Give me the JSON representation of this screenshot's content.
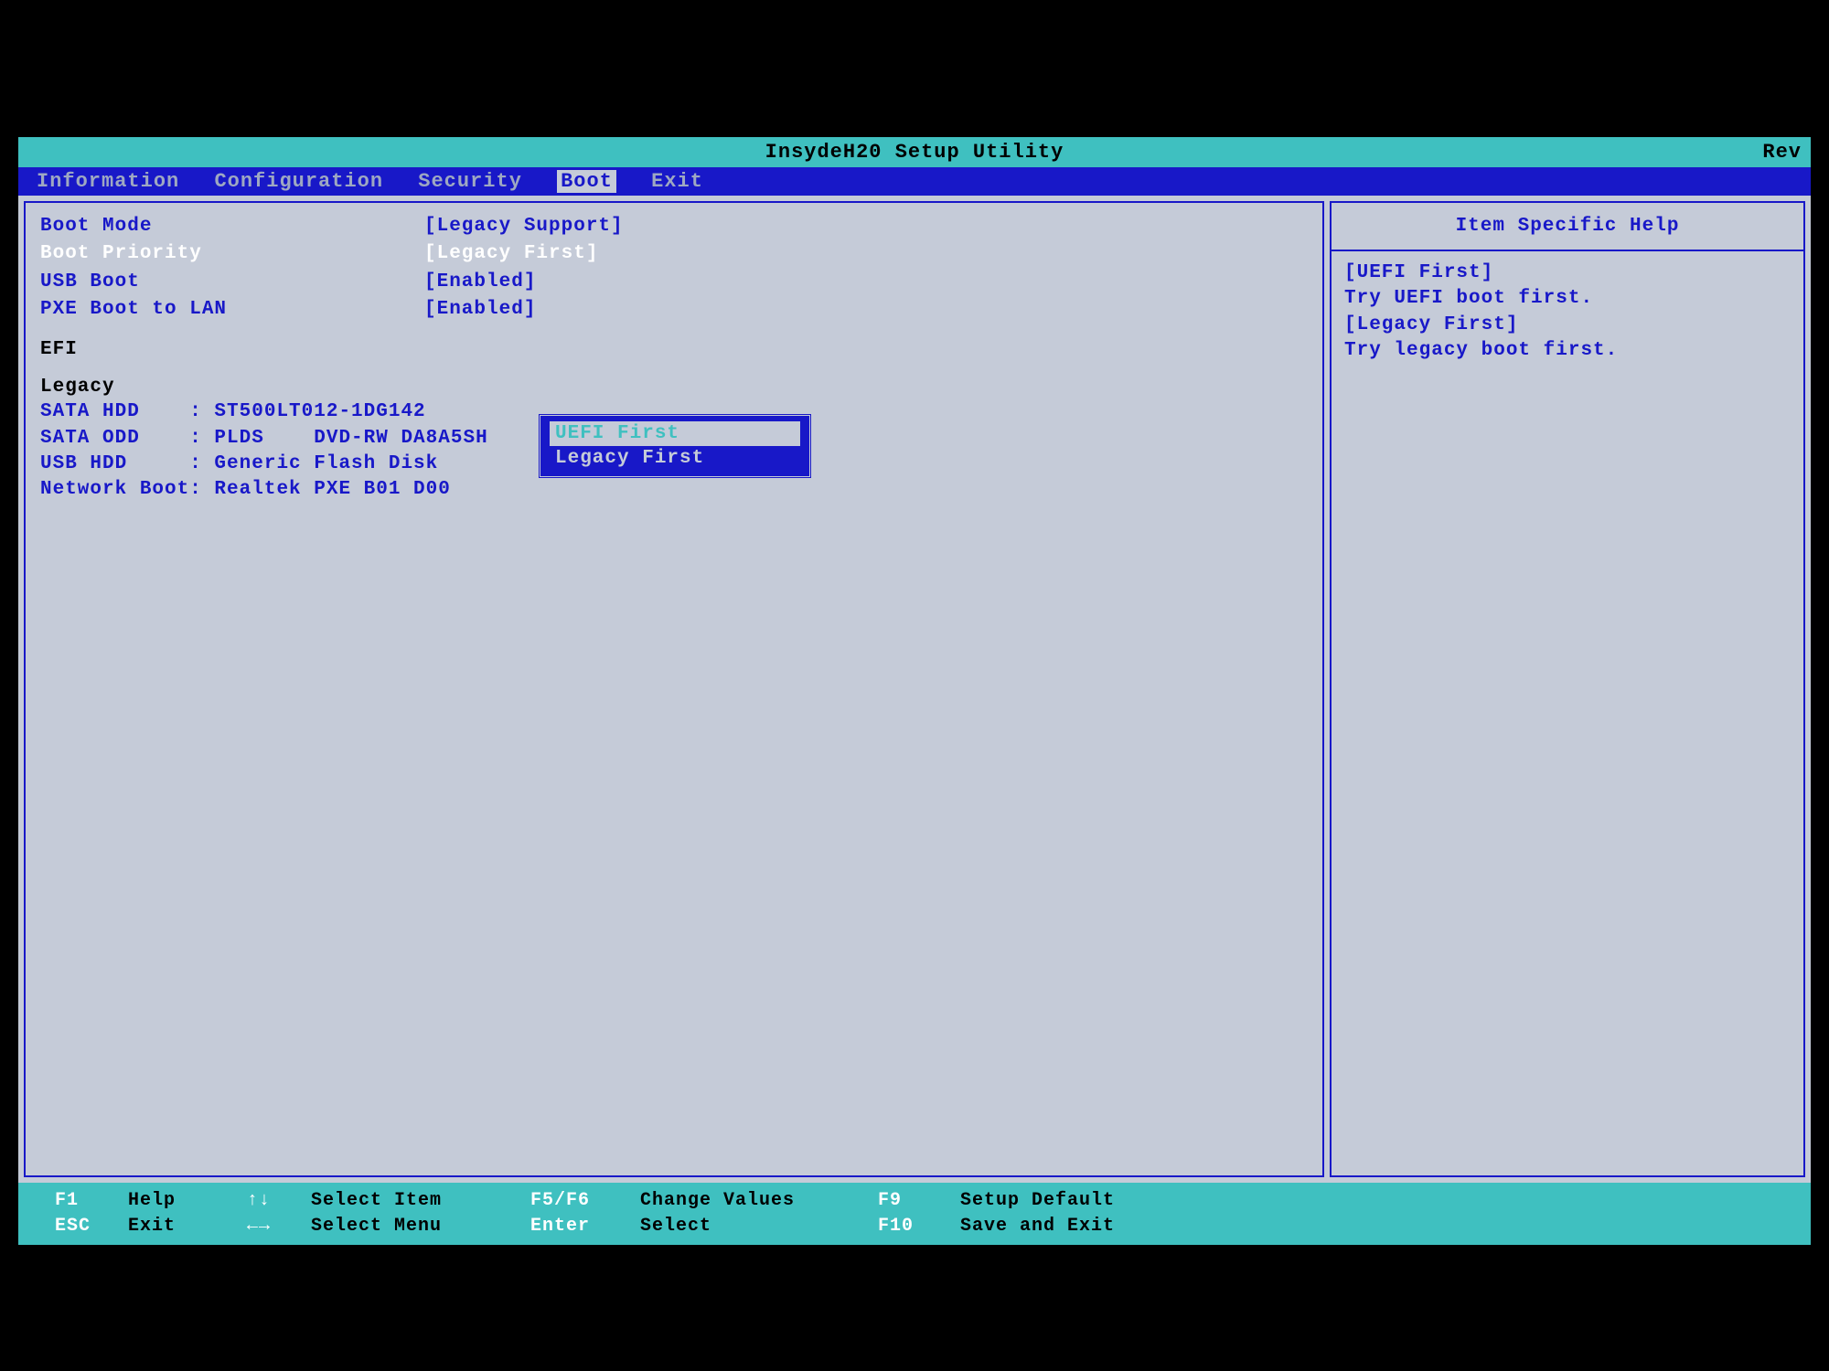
{
  "title": "InsydeH20 Setup Utility",
  "rev": "Rev",
  "menu": {
    "items": [
      "Information",
      "Configuration",
      "Security",
      "Boot",
      "Exit"
    ],
    "active_index": 3
  },
  "settings": [
    {
      "label": "Boot Mode",
      "value": "[Legacy Support]",
      "selected": false
    },
    {
      "label": "Boot Priority",
      "value": "[Legacy First]",
      "selected": true
    },
    {
      "label": "USB Boot",
      "value": "[Enabled]",
      "selected": false
    },
    {
      "label": "PXE Boot to LAN",
      "value": "[Enabled]",
      "selected": false
    }
  ],
  "sections": {
    "efi_header": "EFI",
    "legacy_header": "Legacy",
    "devices": [
      "SATA HDD    : ST500LT012-1DG142",
      "SATA ODD    : PLDS    DVD-RW DA8A5SH",
      "USB HDD     : Generic Flash Disk",
      "Network Boot: Realtek PXE B01 D00"
    ]
  },
  "popup": {
    "options": [
      "UEFI First",
      "Legacy First"
    ],
    "selected_index": 0
  },
  "help": {
    "title": "Item Specific Help",
    "lines": [
      "[UEFI First]",
      "Try UEFI boot first.",
      "[Legacy First]",
      "Try legacy boot first."
    ]
  },
  "footer": {
    "row1": {
      "k1": "F1",
      "l1": "Help",
      "k2": "↑↓",
      "l2": "Select Item",
      "k3": "F5/F6",
      "l3": "Change Values",
      "k4": "F9",
      "l4": "Setup Default"
    },
    "row2": {
      "k1": "ESC",
      "l1": "Exit",
      "k2": "←→",
      "l2": "Select Menu",
      "k3": "Enter",
      "l3": "Select",
      "k4": "F10",
      "l4": "Save and Exit"
    }
  }
}
